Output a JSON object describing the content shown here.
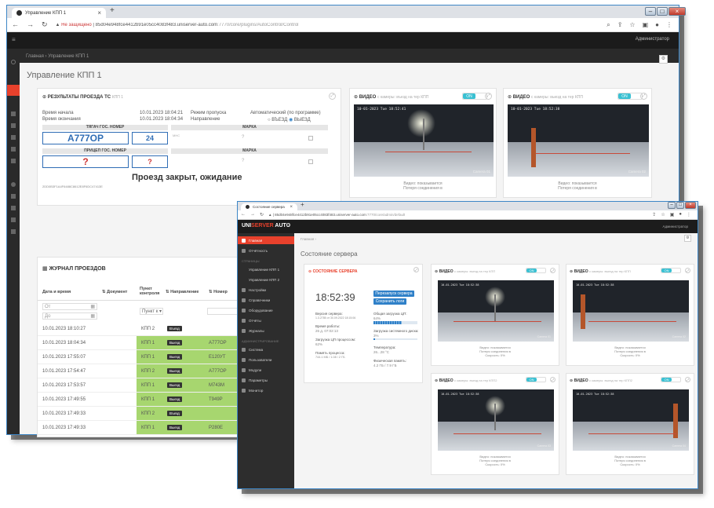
{
  "back_window": {
    "tab_title": "Управление КПП 1",
    "url_warning": "Не защищено",
    "url_host": "85d04e948fce4412b91e05cc4083f483.uniserver-auto.com",
    "url_path": ":7770/core/plugins/AutoControl/Control",
    "user_menu": "Администратор",
    "breadcrumb_home": "Главная",
    "breadcrumb_sep": "›",
    "breadcrumb_current": "Управление КПП 1",
    "page_title": "Управление КПП 1",
    "results": {
      "title": "РЕЗУЛЬТАТЫ ПРОЕЗДА ТС",
      "subtitle": "КПП 1",
      "start_label": "Время начала",
      "start_value": "10.01.2023 18:04:21",
      "end_label": "Время окончания",
      "end_value": "10.01.2023 18:04:34",
      "mode_label": "Режим пропуска",
      "mode_value": "Автоматический (по программе)",
      "direction_label": "Направление",
      "direction_in": "ВЪЕЗД",
      "direction_out": "ВЫЕЗД",
      "tractor_plate_head": "ТЯГАЧ ГОС. НОМЕР",
      "brand_head": "МАРКА",
      "tractor_plate": "А777ОР",
      "tractor_region": "24",
      "trailer_plate_head": "ПРИЦЕП ГОС. НОМЕР",
      "brand_head2": "МАРКА",
      "trailer_plate": "?",
      "trailer_region": "?",
      "brand_unknown": "?",
      "brand_unknown2": "?",
      "intl_label": "МНС",
      "status": "Проезд закрыт, ожидание",
      "session_id": "2DD0B3F1A4F6488C8612E8F6DC47413E"
    },
    "video1": {
      "title": "ВИДЕО",
      "subtitle": "с камеры: въезд на тер КПП",
      "toggle": "ON",
      "ts": "10-01-2023 Tue 18:52:41",
      "cam": "Camera 01",
      "caption1": "Видео: показывается",
      "caption2": "Потеря соединения в"
    },
    "video2": {
      "title": "ВИДЕО",
      "subtitle": "с камеры: выезд на тер КПП",
      "toggle": "ON",
      "ts": "10-01-2023 Tue 18:52:38",
      "cam": "Camera 02",
      "caption1": "Видео: показывается",
      "caption2": "Потеря соединения в"
    },
    "journal": {
      "title": "ЖУРНАЛ ПРОЕЗДОВ",
      "col_datetime": "Дата и время",
      "col_document": "Документ",
      "col_post": "Пункт контроля",
      "col_direction": "Направление",
      "col_plate": "Номер",
      "filter_from": "От",
      "filter_to": "До",
      "filter_post": "Пункт к",
      "rows": [
        {
          "dt": "10.01.2023 18:10:27",
          "post": "КПП 2",
          "dir": "Въезд",
          "plate": "",
          "green": false
        },
        {
          "dt": "10.01.2023 18:04:34",
          "post": "КПП 1",
          "dir": "Выезд",
          "plate": "А777ОР",
          "green": true
        },
        {
          "dt": "10.01.2023 17:55:07",
          "post": "КПП 1",
          "dir": "Выезд",
          "plate": "Е120УТ",
          "green": true
        },
        {
          "dt": "10.01.2023 17:54:47",
          "post": "КПП 2",
          "dir": "Выезд",
          "plate": "А777ОР",
          "green": true
        },
        {
          "dt": "10.01.2023 17:53:57",
          "post": "КПП 1",
          "dir": "Выезд",
          "plate": "М743М",
          "green": true
        },
        {
          "dt": "10.01.2023 17:49:55",
          "post": "КПП 1",
          "dir": "Выезд",
          "plate": "Т949Р",
          "green": true
        },
        {
          "dt": "10.01.2023 17:49:33",
          "post": "КПП 2",
          "dir": "Въезд",
          "plate": "",
          "green": true
        },
        {
          "dt": "10.01.2023 17:49:33",
          "post": "КПП 1",
          "dir": "Выезд",
          "plate": "Р280Е",
          "green": true
        }
      ]
    }
  },
  "front_window": {
    "tab_title": "Состояние сервера",
    "url_host": "85d04e948fce4412b91e05cc4083f483.uniserver-auto.com",
    "url_path": ":7770/core/admin/default",
    "logo_a": "UNI",
    "logo_b": "SERVER",
    "logo_c": " AUTO",
    "user_menu": "Администратор",
    "breadcrumb_home": "Главная",
    "breadcrumb_sep": "›",
    "page_title": "Состояние сервера",
    "sidebar": [
      {
        "label": "Главная",
        "active": true
      },
      {
        "label": "Отчётность",
        "active": false
      },
      {
        "label": "СТРАНИЦЫ",
        "active": false,
        "header": true
      },
      {
        "label": "Управление КПП 1",
        "active": false,
        "sub": true
      },
      {
        "label": "Управление КПП 2",
        "active": false,
        "sub": true
      },
      {
        "label": "Настройки",
        "active": false
      },
      {
        "label": "Справочники",
        "active": false
      },
      {
        "label": "Оборудование",
        "active": false
      },
      {
        "label": "Отчёты",
        "active": false
      },
      {
        "label": "Журналы",
        "active": false
      },
      {
        "label": "АДМИНИСТРИРОВАНИЕ",
        "active": false,
        "header": true
      },
      {
        "label": "Система",
        "active": false
      },
      {
        "label": "Пользователи",
        "active": false
      },
      {
        "label": "Модули",
        "active": false
      },
      {
        "label": "Параметры",
        "active": false
      },
      {
        "label": "Монитор",
        "active": false
      }
    ],
    "server": {
      "title": "СОСТОЯНИЕ СЕРВЕРА",
      "clock": "18:52:39",
      "restart_btn": "Перезапуск сервера",
      "save_log_btn": "Сохранить логи",
      "version_label": "Версия сервера:",
      "version_value": "1.3.2785 от 30.09.2022 18:15:06",
      "uptime_label": "Время работы:",
      "uptime_value": "26 д. 07:02:13",
      "cpu_load_label": "Общая загрузка ЦП:",
      "cpu_load_value": "64%",
      "cpu_proc_label": "Загрузка ЦП процессом:",
      "cpu_proc_value": "62%",
      "disk_label": "Загрузка системного диска:",
      "disk_value": "3%",
      "mem_label": "Память процесса:",
      "mem_value": "744.1 МБ / 1.08 / 2 ГБ",
      "temp_label": "Температура:",
      "temp_value": "26...28 °C",
      "ram_label": "Физическая память:",
      "ram_value": "4.2 ГБ / 7.9 ГБ",
      "cpu_load_fraction": 0.64,
      "disk_fraction": 0.03
    },
    "videos": [
      {
        "title": "ВИДЕО",
        "subtitle": "с камеры: въезд на тер КПП",
        "ts": "10-01-2023 Tue 18:52:38",
        "cam": "Camera 01",
        "caption1": "Видео: показывается",
        "caption2": "Потеря соединения в",
        "caption3": "Скорость: 0%"
      },
      {
        "title": "ВИДЕО",
        "subtitle": "с камеры: выезд на тер КПП",
        "ts": "10-01-2023 Tue 18:52:38",
        "cam": "Camera 02",
        "caption1": "Видео: показывается",
        "caption2": "Потеря соединения в",
        "caption3": "Скорость: 0%"
      },
      {
        "title": "ВИДЕО",
        "subtitle": "с камеры: въезд на тер КПП2",
        "ts": "10-01-2023 Tue 18:52:38",
        "cam": "Camera 03",
        "caption1": "Видео: показывается",
        "caption2": "Потеря соединения в",
        "caption3": "Скорость: 0%"
      },
      {
        "title": "ВИДЕО",
        "subtitle": "с камеры: выезд на тер КПП2",
        "ts": "10-01-2023 Tue 18:52:38",
        "cam": "Camera 04",
        "caption1": "Видео: показывается",
        "caption2": "Потеря соединения в",
        "caption3": "Скорость: 0%"
      }
    ],
    "toggle_label": "ON"
  },
  "colors": {
    "accent_red": "#e8412c",
    "accent_cyan": "#39c0d2",
    "green_row": "#a7d66f",
    "blue": "#2f80c8"
  }
}
